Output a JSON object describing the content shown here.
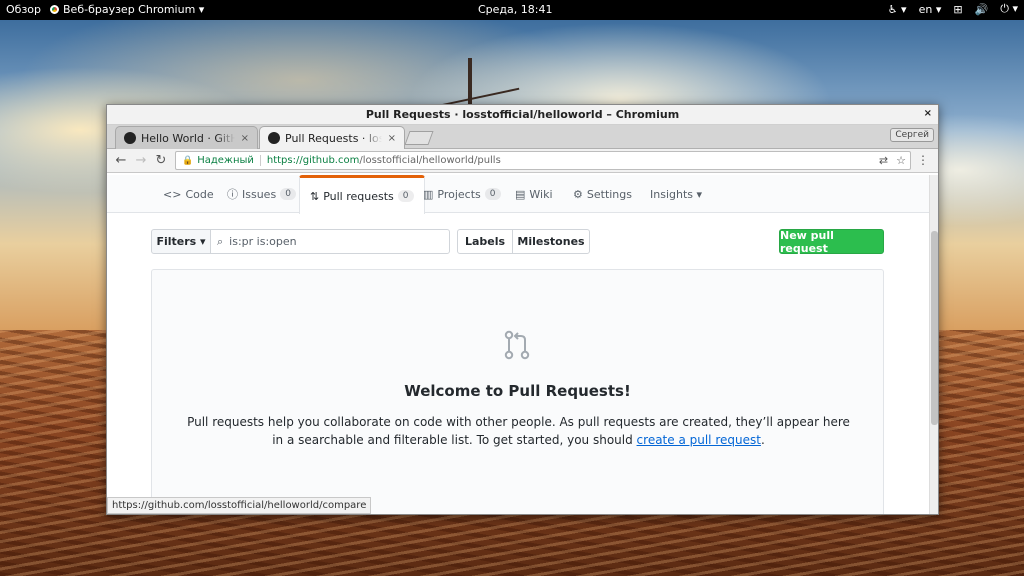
{
  "desktop": {
    "overview": "Обзор",
    "app_name": "Веб-браузер Chromium ▾",
    "clock": "Среда, 18:41",
    "lang": "en ▾"
  },
  "window": {
    "title": "Pull Requests · losstofficial/helloworld – Chromium",
    "profile": "Сергей"
  },
  "tabs": [
    {
      "label": "Hello World · GitHub"
    },
    {
      "label": "Pull Requests · losstofficial/helloworld"
    }
  ],
  "omnibox": {
    "secure_label": "Надежный",
    "url_scheme_host": "https://github.com",
    "url_path": "/losstofficial/helloworld/pulls"
  },
  "reponav": {
    "code": "Code",
    "issues": "Issues",
    "issues_count": "0",
    "pulls": "Pull requests",
    "pulls_count": "0",
    "projects": "Projects",
    "projects_count": "0",
    "wiki": "Wiki",
    "settings": "Settings",
    "insights": "Insights ▾"
  },
  "filters": {
    "filters_label": "Filters ▾",
    "search_value": "is:pr is:open",
    "labels": "Labels",
    "milestones": "Milestones",
    "new_pr": "New pull request"
  },
  "blankslate": {
    "heading": "Welcome to Pull Requests!",
    "text_before": "Pull requests help you collaborate on code with other people. As pull requests are created, they’ll appear here in a searchable and filterable list. To get started, you should ",
    "link": "create a pull request",
    "text_after": "."
  },
  "status_url": "https://github.com/losstofficial/helloworld/compare"
}
